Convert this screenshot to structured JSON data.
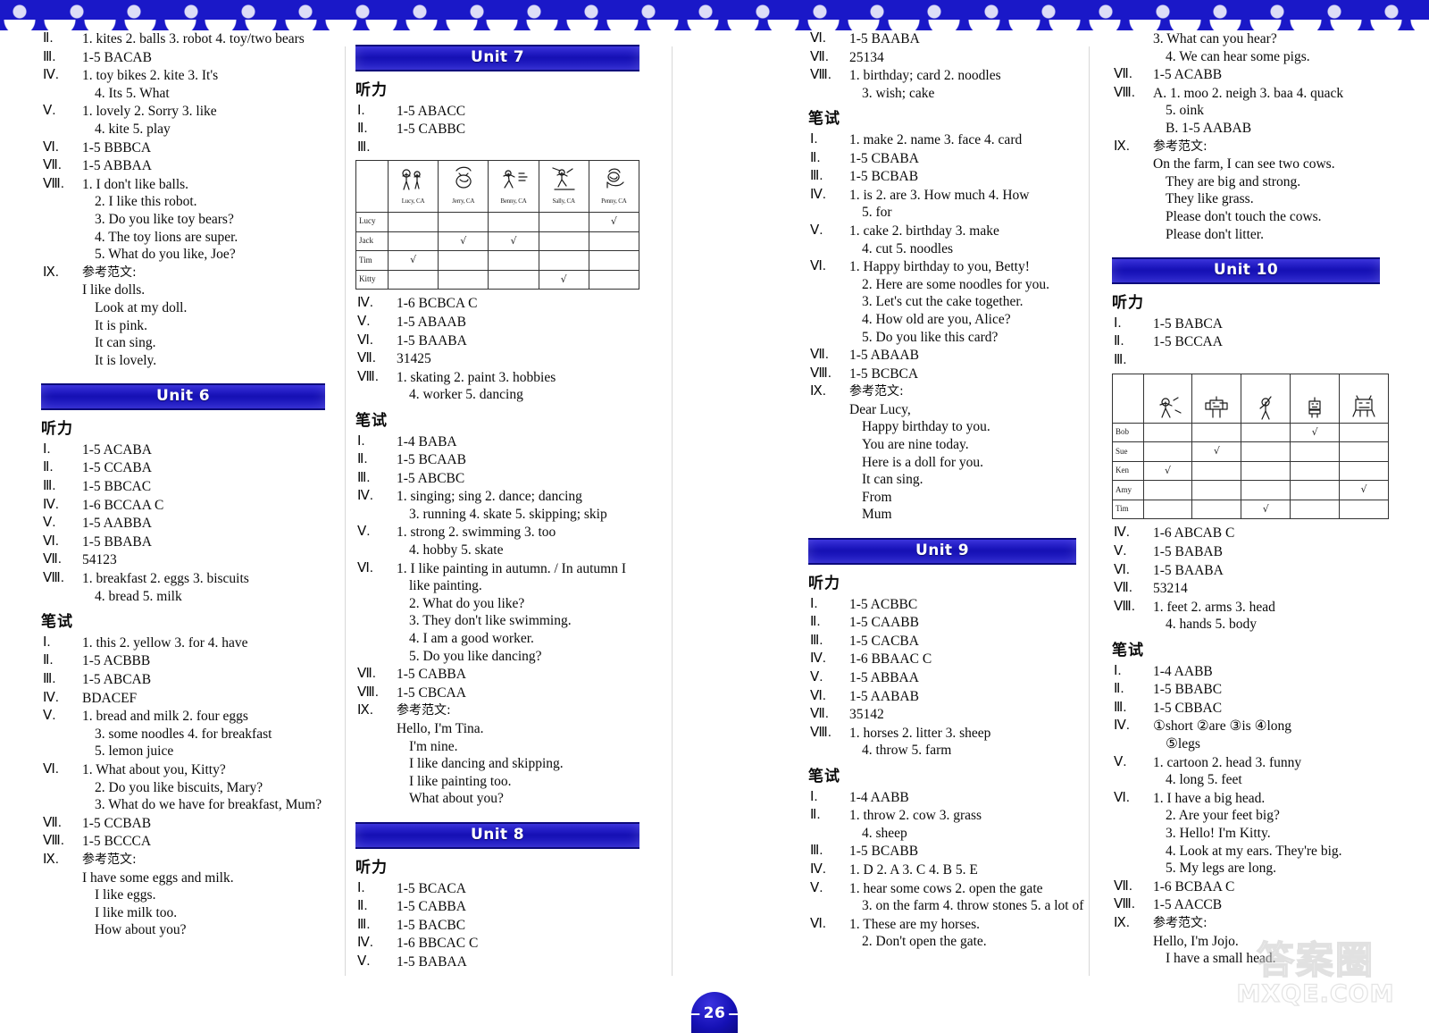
{
  "page": {
    "number": "26",
    "dash": "—"
  },
  "watermark": {
    "cn": "答案圈",
    "en": "MXQE.COM"
  },
  "labels": {
    "listening": "听力",
    "written": "笔试",
    "sample_essay": "参考范文:"
  },
  "columns": [
    {
      "id": "col-1",
      "blocks": [
        {
          "type": "answers",
          "rows": [
            {
              "num": "Ⅱ.",
              "lines": [
                "1. kites   2. balls   3. robot   4. toy/two bears"
              ]
            },
            {
              "num": "Ⅲ.",
              "lines": [
                "1-5   BACAB"
              ]
            },
            {
              "num": "Ⅳ.",
              "lines": [
                "1. toy bikes   2. kite   3. It's",
                "4. Its   5. What"
              ]
            },
            {
              "num": "Ⅴ.",
              "lines": [
                "1. lovely   2. Sorry   3. like",
                "4. kite   5. play"
              ]
            },
            {
              "num": "Ⅵ.",
              "lines": [
                "1-5   BBBCA"
              ]
            },
            {
              "num": "Ⅶ.",
              "lines": [
                "1-5   ABBAA"
              ]
            },
            {
              "num": "Ⅷ.",
              "lines": [
                "1. I don't like balls.",
                "2. I like this robot.",
                "3. Do you like toy bears?",
                "4. The toy lions are super.",
                "5. What do you like, Joe?"
              ]
            },
            {
              "num": "Ⅸ.",
              "zh": "参考范文:",
              "lines": [
                "I like dolls.",
                "Look at my doll.",
                "It is pink.",
                "It can sing.",
                "It is lovely."
              ]
            }
          ]
        },
        {
          "type": "banner",
          "title": "Unit 6",
          "style": "b-u6"
        },
        {
          "type": "section",
          "head": "听力",
          "rows": [
            {
              "num": "Ⅰ.",
              "lines": [
                "1-5   ACABA"
              ]
            },
            {
              "num": "Ⅱ.",
              "lines": [
                "1-5   CCABA"
              ]
            },
            {
              "num": "Ⅲ.",
              "lines": [
                "1-5   BBCAC"
              ]
            },
            {
              "num": "Ⅳ.",
              "lines": [
                "1-6   BCCAA C"
              ]
            },
            {
              "num": "Ⅴ.",
              "lines": [
                "1-5   AABBA"
              ]
            },
            {
              "num": "Ⅵ.",
              "lines": [
                "1-5   BBABA"
              ]
            },
            {
              "num": "Ⅶ.",
              "lines": [
                "54123"
              ]
            },
            {
              "num": "Ⅷ.",
              "lines": [
                "1. breakfast   2. eggs   3. biscuits",
                "4. bread   5. milk"
              ]
            }
          ]
        },
        {
          "type": "section",
          "head": "笔试",
          "rows": [
            {
              "num": "Ⅰ.",
              "lines": [
                "1. this   2. yellow   3. for   4. have"
              ]
            },
            {
              "num": "Ⅱ.",
              "lines": [
                "1-5   ACBBB"
              ]
            },
            {
              "num": "Ⅲ.",
              "lines": [
                "1-5   ABCAB"
              ]
            },
            {
              "num": "Ⅳ.",
              "lines": [
                "BDACEF"
              ]
            },
            {
              "num": "Ⅴ.",
              "lines": [
                "1. bread and milk   2. four eggs",
                "3. some noodles   4. for breakfast",
                "5. lemon juice"
              ]
            },
            {
              "num": "Ⅵ.",
              "lines": [
                "1. What about you, Kitty?",
                "2. Do you like biscuits, Mary?",
                "3. What do we have for breakfast, Mum?"
              ]
            },
            {
              "num": "Ⅶ.",
              "lines": [
                "1-5   CCBAB"
              ]
            },
            {
              "num": "Ⅷ.",
              "lines": [
                "1-5   BCCCA"
              ]
            },
            {
              "num": "Ⅸ.",
              "zh": "参考范文:",
              "lines": [
                "I have some eggs and milk.",
                "I like eggs.",
                "I like milk too.",
                "How about you?"
              ]
            }
          ]
        }
      ]
    },
    {
      "id": "col-2",
      "blocks": [
        {
          "type": "banner",
          "title": "Unit 7",
          "style": "b-w7"
        },
        {
          "type": "section",
          "head": "听力",
          "rows": [
            {
              "num": "Ⅰ.",
              "lines": [
                "1-5   ABACC"
              ]
            },
            {
              "num": "Ⅱ.",
              "lines": [
                "1-5   CABBC"
              ]
            },
            {
              "num": "Ⅲ.",
              "lines": []
            }
          ]
        },
        {
          "type": "table",
          "name": "unit7-listening-table",
          "col_captions": [
            "Lucy, CA",
            "Jerry, CA",
            "Benny, CA",
            "Sally, CA",
            "Penny, CA"
          ],
          "col_icons": [
            "kids-playing-icon",
            "boy-face-icon",
            "running-kids-icon",
            "skating-kids-icon",
            "boy-playing-icon"
          ],
          "row_labels": [
            "Lucy",
            "Jack",
            "Tim",
            "Kitty"
          ],
          "marks": [
            [
              0,
              0,
              0,
              0,
              1
            ],
            [
              0,
              1,
              1,
              0,
              0
            ],
            [
              1,
              0,
              0,
              0,
              0
            ],
            [
              0,
              0,
              0,
              1,
              0
            ]
          ]
        },
        {
          "type": "answers",
          "rows": [
            {
              "num": "Ⅳ.",
              "lines": [
                "1-6   BCBCA C"
              ]
            },
            {
              "num": "Ⅴ.",
              "lines": [
                "1-5   ABAAB"
              ]
            },
            {
              "num": "Ⅵ.",
              "lines": [
                "1-5   BAABA"
              ]
            },
            {
              "num": "Ⅶ.",
              "lines": [
                "31425"
              ]
            },
            {
              "num": "Ⅷ.",
              "lines": [
                "1. skating   2. paint   3. hobbies",
                "4. worker   5. dancing"
              ]
            }
          ]
        },
        {
          "type": "section",
          "head": "笔试",
          "rows": [
            {
              "num": "Ⅰ.",
              "lines": [
                "1-4   BABA"
              ]
            },
            {
              "num": "Ⅱ.",
              "lines": [
                "1-5   BCAAB"
              ]
            },
            {
              "num": "Ⅲ.",
              "lines": [
                "1-5   ABCBC"
              ]
            },
            {
              "num": "Ⅳ.",
              "lines": [
                "1. singing; sing   2. dance; dancing",
                "3. running   4. skate   5. skipping; skip"
              ]
            },
            {
              "num": "Ⅴ.",
              "lines": [
                "1. strong   2. swimming   3. too",
                "4. hobby   5. skate"
              ]
            },
            {
              "num": "Ⅵ.",
              "lines": [
                "1. I like painting in autumn. / In autumn I",
                "like painting.",
                "2. What do you like?",
                "3. They don't like swimming.",
                "4. I am a good worker.",
                "5. Do you like dancing?"
              ]
            },
            {
              "num": "Ⅶ.",
              "lines": [
                "1-5   CABBA"
              ]
            },
            {
              "num": "Ⅷ.",
              "lines": [
                "1-5   CBCAA"
              ]
            },
            {
              "num": "Ⅸ.",
              "zh": "参考范文:",
              "lines": [
                "Hello, I'm Tina.",
                "I'm nine.",
                "I like dancing and skipping.",
                "I like painting too.",
                "What about you?"
              ]
            }
          ]
        },
        {
          "type": "banner",
          "title": "Unit 8",
          "style": "b-u8"
        },
        {
          "type": "section",
          "head": "听力",
          "rows": [
            {
              "num": "Ⅰ.",
              "lines": [
                "1-5   BCACA"
              ]
            },
            {
              "num": "Ⅱ.",
              "lines": [
                "1-5   CABBA"
              ]
            },
            {
              "num": "Ⅲ.",
              "lines": [
                "1-5   BACBC"
              ]
            },
            {
              "num": "Ⅳ.",
              "lines": [
                "1-6   BBCAC C"
              ]
            },
            {
              "num": "Ⅴ.",
              "lines": [
                "1-5   BABAA"
              ]
            }
          ]
        }
      ]
    },
    {
      "id": "col-3",
      "blocks": [
        {
          "type": "answers",
          "rows": [
            {
              "num": "Ⅵ.",
              "lines": [
                "1-5   BAABA"
              ]
            },
            {
              "num": "Ⅶ.",
              "lines": [
                "25134"
              ]
            },
            {
              "num": "Ⅷ.",
              "lines": [
                "1. birthday; card   2. noodles",
                "3. wish; cake"
              ]
            }
          ]
        },
        {
          "type": "section",
          "head": "笔试",
          "rows": [
            {
              "num": "Ⅰ.",
              "lines": [
                "1. make   2. name   3. face   4. card"
              ]
            },
            {
              "num": "Ⅱ.",
              "lines": [
                "1-5   CBABA"
              ]
            },
            {
              "num": "Ⅲ.",
              "lines": [
                "1-5   BCBAB"
              ]
            },
            {
              "num": "Ⅳ.",
              "lines": [
                "1. is   2. are   3. How much   4. How",
                "5. for"
              ]
            },
            {
              "num": "Ⅴ.",
              "lines": [
                "1. cake   2. birthday   3. make",
                "4. cut   5. noodles"
              ]
            },
            {
              "num": "Ⅵ.",
              "lines": [
                "1. Happy birthday to you, Betty!",
                "2. Here are some noodles for you.",
                "3. Let's cut the cake together.",
                "4. How old are you, Alice?",
                "5. Do you like this card?"
              ]
            },
            {
              "num": "Ⅶ.",
              "lines": [
                "1-5   ABAAB"
              ]
            },
            {
              "num": "Ⅷ.",
              "lines": [
                "1-5   BCBCA"
              ]
            },
            {
              "num": "Ⅸ.",
              "zh": "参考范文:",
              "lines": [
                "Dear Lucy,",
                "Happy birthday to you.",
                "You are nine today.",
                "Here is a doll for you.",
                "It can sing.",
                "From",
                "Mum"
              ]
            }
          ]
        },
        {
          "type": "banner",
          "title": "Unit 9",
          "style": "b-u9"
        },
        {
          "type": "section",
          "head": "听力",
          "rows": [
            {
              "num": "Ⅰ.",
              "lines": [
                "1-5   ACBBC"
              ]
            },
            {
              "num": "Ⅱ.",
              "lines": [
                "1-5   CAABB"
              ]
            },
            {
              "num": "Ⅲ.",
              "lines": [
                "1-5   CACBA"
              ]
            },
            {
              "num": "Ⅳ.",
              "lines": [
                "1-6   BBAAC C"
              ]
            },
            {
              "num": "Ⅴ.",
              "lines": [
                "1-5   ABBAA"
              ]
            },
            {
              "num": "Ⅵ.",
              "lines": [
                "1-5   AABAB"
              ]
            },
            {
              "num": "Ⅶ.",
              "lines": [
                "35142"
              ]
            },
            {
              "num": "Ⅷ.",
              "lines": [
                "1. horses   2. litter   3. sheep",
                "4. throw   5. farm"
              ]
            }
          ]
        },
        {
          "type": "section",
          "head": "笔试",
          "rows": [
            {
              "num": "Ⅰ.",
              "lines": [
                "1-4   AABB"
              ]
            },
            {
              "num": "Ⅱ.",
              "lines": [
                "1. throw   2. cow   3. grass",
                "4. sheep"
              ]
            },
            {
              "num": "Ⅲ.",
              "lines": [
                "1-5   BCABB"
              ]
            },
            {
              "num": "Ⅳ.",
              "lines": [
                "1. D   2. A   3. C   4. B   5. E"
              ]
            },
            {
              "num": "Ⅴ.",
              "lines": [
                "1. hear some cows   2. open the gate",
                "3. on the farm   4. throw stones   5. a lot of"
              ]
            },
            {
              "num": "Ⅵ.",
              "lines": [
                "1. These are my horses.",
                "2. Don't open the gate."
              ]
            }
          ]
        }
      ]
    },
    {
      "id": "col-4",
      "blocks": [
        {
          "type": "answers",
          "rows": [
            {
              "num": "",
              "lines": [
                "3. What can you hear?",
                "4. We can hear some pigs."
              ]
            },
            {
              "num": "Ⅶ.",
              "lines": [
                "1-5   ACABB"
              ]
            },
            {
              "num": "Ⅷ.",
              "lines": [
                "A. 1. moo   2. neigh   3. baa   4. quack",
                "5. oink",
                "B. 1-5   AABAB"
              ]
            },
            {
              "num": "Ⅸ.",
              "zh": "参考范文:",
              "lines": [
                "On the farm, I can see two cows.",
                "They are big and strong.",
                "They like grass.",
                "Please don't touch the cows.",
                "Please don't litter."
              ]
            }
          ]
        },
        {
          "type": "banner",
          "title": "Unit 10",
          "style": "b-u10"
        },
        {
          "type": "section",
          "head": "听力",
          "rows": [
            {
              "num": "Ⅰ.",
              "lines": [
                "1-5   BABCA"
              ]
            },
            {
              "num": "Ⅱ.",
              "lines": [
                "1-5   BCCAA"
              ]
            },
            {
              "num": "Ⅲ.",
              "lines": []
            }
          ]
        },
        {
          "type": "table",
          "name": "unit10-listening-table",
          "col_captions": [
            "",
            "",
            "",
            "",
            ""
          ],
          "col_icons": [
            "girl-dancing-icon",
            "robot-icon",
            "person-waving-icon",
            "robot-small-icon",
            "monster-icon"
          ],
          "row_labels": [
            "Bob",
            "Sue",
            "Ken",
            "Amy",
            "Tim"
          ],
          "marks": [
            [
              0,
              0,
              0,
              1,
              0
            ],
            [
              0,
              1,
              0,
              0,
              0
            ],
            [
              1,
              0,
              0,
              0,
              0
            ],
            [
              0,
              0,
              0,
              0,
              1
            ],
            [
              0,
              0,
              1,
              0,
              0
            ]
          ]
        },
        {
          "type": "answers",
          "rows": [
            {
              "num": "Ⅳ.",
              "lines": [
                "1-6   ABCAB C"
              ]
            },
            {
              "num": "Ⅴ.",
              "lines": [
                "1-5   BABAB"
              ]
            },
            {
              "num": "Ⅵ.",
              "lines": [
                "1-5   BAABA"
              ]
            },
            {
              "num": "Ⅶ.",
              "lines": [
                "53214"
              ]
            },
            {
              "num": "Ⅷ.",
              "lines": [
                "1. feet   2. arms   3. head",
                "4. hands   5. body"
              ]
            }
          ]
        },
        {
          "type": "section",
          "head": "笔试",
          "rows": [
            {
              "num": "Ⅰ.",
              "lines": [
                "1-4   AABB"
              ]
            },
            {
              "num": "Ⅱ.",
              "lines": [
                "1-5   BBABC"
              ]
            },
            {
              "num": "Ⅲ.",
              "lines": [
                "1-5   CBBAC"
              ]
            },
            {
              "num": "Ⅳ.",
              "lines": [
                "①short   ②are   ③is   ④long",
                "⑤legs"
              ]
            },
            {
              "num": "Ⅴ.",
              "lines": [
                "1. cartoon   2. head   3. funny",
                "4. long   5. feet"
              ]
            },
            {
              "num": "Ⅵ.",
              "lines": [
                "1. I have a big head.",
                "2. Are your feet big?",
                "3. Hello! I'm Kitty.",
                "4. Look at my ears. They're big.",
                "5. My legs are long."
              ]
            },
            {
              "num": "Ⅶ.",
              "lines": [
                "1-6   BCBAA C"
              ]
            },
            {
              "num": "Ⅷ.",
              "lines": [
                "1-5   AACCB"
              ]
            },
            {
              "num": "Ⅸ.",
              "zh": "参考范文:",
              "lines": [
                "Hello, I'm Jojo.",
                "I have a small head."
              ]
            }
          ]
        }
      ]
    }
  ]
}
